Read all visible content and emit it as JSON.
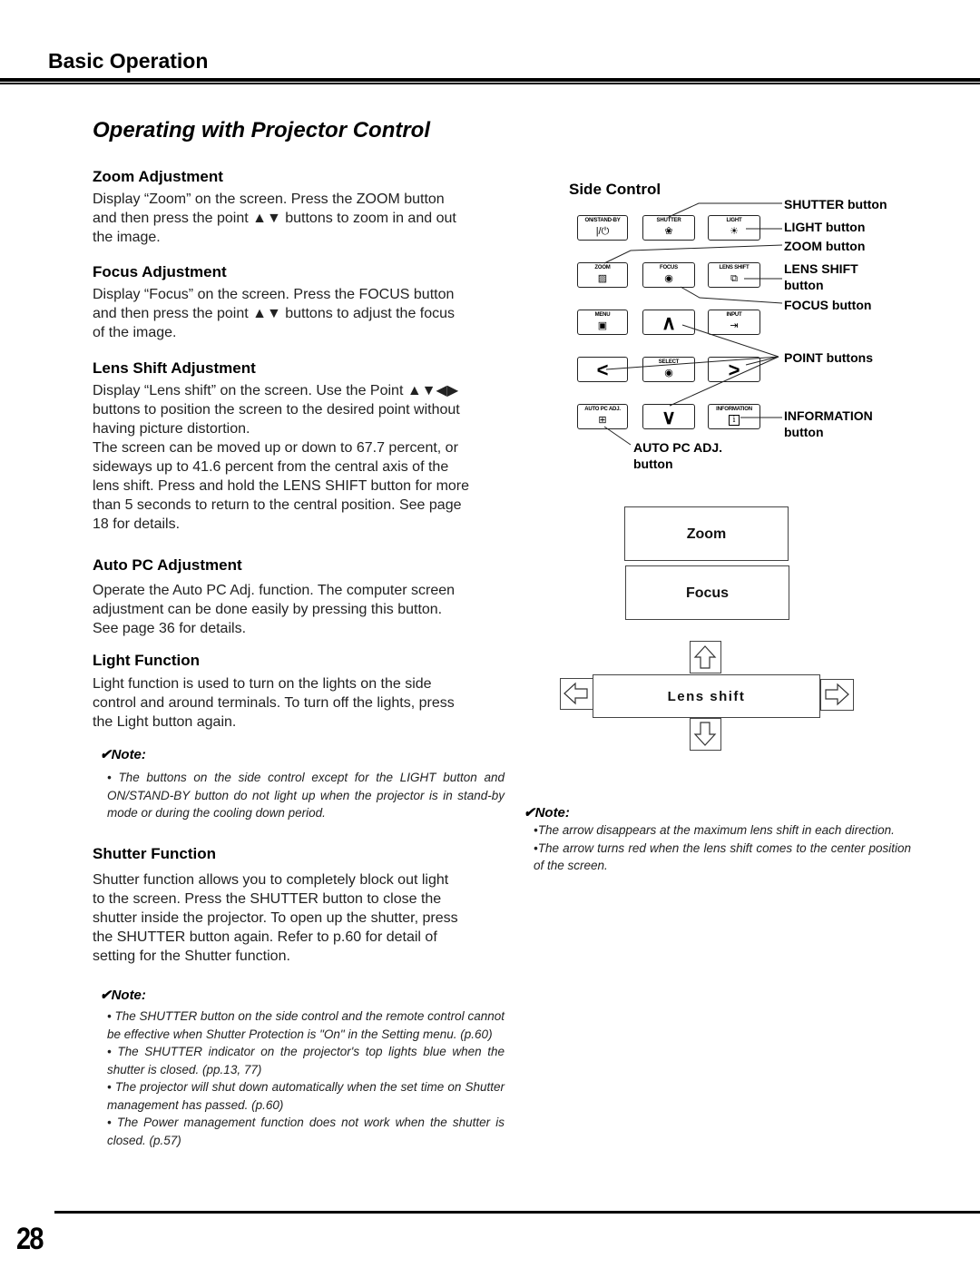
{
  "header": {
    "section": "Basic Operation",
    "title": "Operating with Projector Control"
  },
  "sections": {
    "zoom": {
      "heading": "Zoom Adjustment",
      "lines": [
        "Display “Zoom” on the screen. Press the ZOOM button",
        "and then press the point ▲▼ buttons to zoom in and out",
        "the image."
      ]
    },
    "focus": {
      "heading": "Focus Adjustment",
      "lines": [
        "Display “Focus” on the screen. Press the FOCUS button",
        "and then press the point ▲▼ buttons to adjust the focus",
        "of the image."
      ]
    },
    "lens_shift": {
      "heading": "Lens Shift Adjustment",
      "lines": [
        "Display “Lens shift” on the screen. Use the Point ▲▼◀▶",
        "buttons to position the screen to the desired point without",
        "having picture distortion.",
        "The screen can be moved up or down to 67.7 percent, or",
        "sideways up to 41.6 percent from the central axis of the",
        "lens shift. Press and hold the LENS SHIFT button for more",
        "than 5 seconds to return to the central position. See page",
        "18 for details."
      ]
    },
    "auto_pc": {
      "heading": "Auto PC Adjustment",
      "lines": [
        "Operate the Auto PC Adj. function. The computer screen",
        "adjustment can be done easily by pressing this button.",
        "See page 36 for details."
      ]
    },
    "light": {
      "heading": "Light Function",
      "lines": [
        "Light function is used to turn on the lights on the side",
        "control and around terminals. To turn off the lights, press",
        "the Light button again."
      ],
      "note_title": "✔Note:",
      "notes": [
        "• The buttons on the side control except for the LIGHT button and ON/STAND-BY button do not light up when the projector is in stand-by mode or during the cooling down period."
      ]
    },
    "shutter": {
      "heading": "Shutter Function",
      "lines": [
        "Shutter function allows you to completely block out light",
        "to the screen. Press the SHUTTER button to close the",
        "shutter inside the projector. To open up the shutter, press",
        "the SHUTTER button again. Refer to p.60 for detail of",
        "setting for the Shutter function."
      ],
      "note_title": "✔Note:",
      "notes": [
        "• The SHUTTER button on the side control and the remote control cannot be effective when Shutter Protection is \"On\" in the Setting menu. (p.60)",
        "• The SHUTTER indicator on the projector's top lights blue when the shutter is closed. (pp.13, 77)",
        "• The projector will shut down automatically when the set time on Shutter management has passed. (p.60)",
        "• The Power management function does not work when the shutter is closed. (p.57)"
      ]
    }
  },
  "side_control": {
    "title": "Side Control",
    "buttons": [
      {
        "label": "ON/STAND-BY",
        "icon": "|/⏻",
        "icon_name": "power-icon"
      },
      {
        "label": "SHUTTER",
        "icon": "❀",
        "icon_name": "shutter-icon"
      },
      {
        "label": "LIGHT",
        "icon": "☀",
        "icon_name": "light-icon"
      },
      {
        "label": "ZOOM",
        "icon": "▨",
        "icon_name": "zoom-icon"
      },
      {
        "label": "FOCUS",
        "icon": "◉",
        "icon_name": "focus-icon"
      },
      {
        "label": "LENS SHIFT",
        "icon": "⧉",
        "icon_name": "lens-shift-icon"
      },
      {
        "label": "MENU",
        "icon": "▣",
        "icon_name": "menu-icon"
      },
      {
        "label": "",
        "icon": "∧",
        "icon_name": "arrow-up-icon"
      },
      {
        "label": "INPUT",
        "icon": "⇥",
        "icon_name": "input-icon"
      },
      {
        "label": "",
        "icon": "<",
        "icon_name": "arrow-left-icon"
      },
      {
        "label": "SELECT",
        "icon": "◉",
        "icon_name": "select-icon"
      },
      {
        "label": "",
        "icon": ">",
        "icon_name": "arrow-right-icon"
      },
      {
        "label": "AUTO PC ADJ.",
        "icon": "⊞",
        "icon_name": "auto-pc-icon"
      },
      {
        "label": "",
        "icon": "∨",
        "icon_name": "arrow-down-icon"
      },
      {
        "label": "INFORMATION",
        "icon": "i",
        "icon_name": "information-icon"
      }
    ],
    "callouts": {
      "shutter": "SHUTTER button",
      "light": "LIGHT button",
      "zoom": "ZOOM button",
      "lens_shift_1": "LENS SHIFT",
      "lens_shift_2": "button",
      "focus": "FOCUS button",
      "point": "POINT buttons",
      "information_1": "INFORMATION",
      "information_2": "button",
      "auto_pc_1": "AUTO PC ADJ.",
      "auto_pc_2": "button"
    }
  },
  "osd": {
    "zoom": "Zoom",
    "focus": "Focus",
    "lens_shift": "Lens shift"
  },
  "right_note": {
    "title": "✔Note:",
    "notes": [
      "•The arrow disappears at the maximum lens shift in each direction.",
      "•The arrow turns red when the lens shift comes to the center position of the screen."
    ]
  },
  "footer": {
    "page_number": "28"
  }
}
